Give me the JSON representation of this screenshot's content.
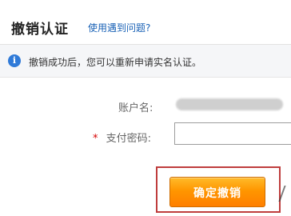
{
  "page": {
    "title": "撤销认证",
    "help_link": "使用遇到问题?"
  },
  "notice": {
    "icon": "info-icon",
    "text": "撤销成功后，您可以重新申请实名认证。"
  },
  "form": {
    "account_label": "账户名:",
    "password_label": "支付密码:",
    "required_mark": "*",
    "password_placeholder": ""
  },
  "actions": {
    "confirm_label": "确定撤销"
  },
  "colors": {
    "accent": "#ff8a00",
    "link": "#1a62b6",
    "highlight": "#bf3d3d"
  }
}
